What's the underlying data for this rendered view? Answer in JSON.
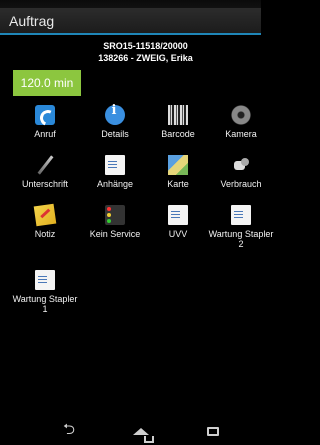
{
  "header": {
    "title": "Auftrag"
  },
  "order": {
    "number": "SRO15-11518/20000",
    "customer": "138266 - ZWEIG, Erika"
  },
  "timer": {
    "label": "120.0 min"
  },
  "tiles": [
    {
      "label": "Anruf",
      "icon": "phone-icon"
    },
    {
      "label": "Details",
      "icon": "info-icon"
    },
    {
      "label": "Barcode",
      "icon": "barcode-icon"
    },
    {
      "label": "Kamera",
      "icon": "camera-icon"
    },
    {
      "label": "Unterschrift",
      "icon": "pen-icon"
    },
    {
      "label": "Anhänge",
      "icon": "document-icon"
    },
    {
      "label": "Karte",
      "icon": "map-icon"
    },
    {
      "label": "Verbrauch",
      "icon": "parts-icon"
    },
    {
      "label": "Notiz",
      "icon": "note-icon"
    },
    {
      "label": "Kein Service",
      "icon": "traffic-light-icon"
    },
    {
      "label": "UVV",
      "icon": "document-icon"
    },
    {
      "label": "Wartung Stapler 2",
      "icon": "document-icon"
    },
    {
      "label": "Wartung Stapler 1",
      "icon": "document-icon"
    }
  ],
  "colors": {
    "accent": "#1f86b8",
    "timer_bg": "#8cc63f"
  }
}
